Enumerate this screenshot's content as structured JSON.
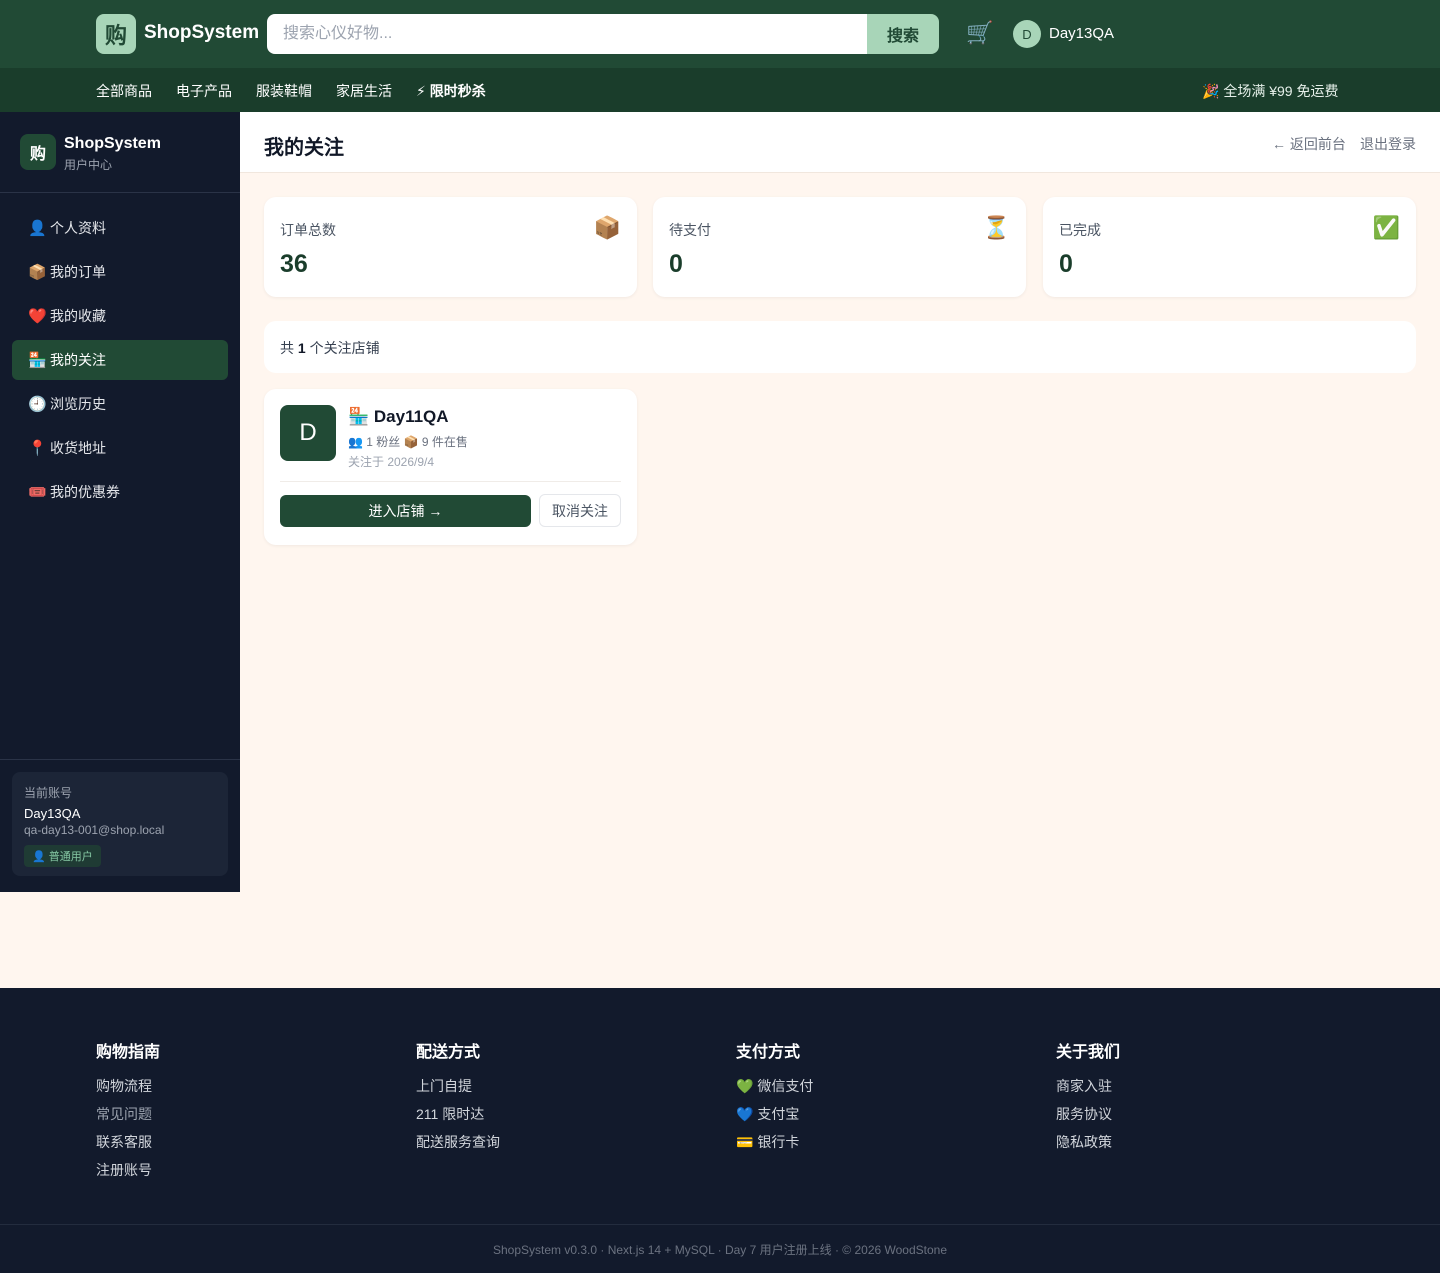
{
  "header": {
    "logo_char": "购",
    "brand": "ShopSystem",
    "search_placeholder": "搜索心仪好物...",
    "search_button": "搜索",
    "cart_icon": "🛒",
    "avatar_initial": "D",
    "user_name": "Day13QA"
  },
  "nav": {
    "items": [
      "全部商品",
      "电子产品",
      "服装鞋帽",
      "家居生活"
    ],
    "flash_icon": "⚡",
    "flash_label": "限时秒杀",
    "promo": "🎉 全场满 ¥99 免运费"
  },
  "sidebar": {
    "logo_char": "购",
    "title": "ShopSystem",
    "subtitle": "用户中心",
    "items": [
      {
        "icon": "👤",
        "label": "个人资料"
      },
      {
        "icon": "📦",
        "label": "我的订单"
      },
      {
        "icon": "❤️",
        "label": "我的收藏"
      },
      {
        "icon": "🏪",
        "label": "我的关注"
      },
      {
        "icon": "🕘",
        "label": "浏览历史"
      },
      {
        "icon": "📍",
        "label": "收货地址"
      },
      {
        "icon": "🎟️",
        "label": "我的优惠券"
      }
    ],
    "account": {
      "label": "当前账号",
      "name": "Day13QA",
      "email": "qa-day13-001@shop.local",
      "badge": "👤 普通用户"
    }
  },
  "main": {
    "title": "我的关注",
    "back": "← 返回前台",
    "logout": "退出登录",
    "stats": [
      {
        "label": "订单总数",
        "value": "36",
        "icon": "📦"
      },
      {
        "label": "待支付",
        "value": "0",
        "icon": "⏳"
      },
      {
        "label": "已完成",
        "value": "0",
        "icon": "✅"
      }
    ],
    "count_prefix": "共",
    "count": "1",
    "count_suffix": "个关注店铺",
    "shop": {
      "initial": "D",
      "name": "🏪 Day11QA",
      "meta": "👥 1 粉丝 📦 9 件在售",
      "date": "关注于 2026/9/4",
      "enter": "进入店铺 →",
      "unfollow": "取消关注"
    }
  },
  "footer": {
    "columns": [
      {
        "title": "购物指南",
        "links": [
          "购物流程",
          "常见问题",
          "联系客服",
          "注册账号"
        ]
      },
      {
        "title": "配送方式",
        "links": [
          "上门自提",
          "211 限时达",
          "配送服务查询"
        ]
      },
      {
        "title": "支付方式",
        "links": [
          "💚 微信支付",
          "💙 支付宝",
          "💳 银行卡"
        ]
      },
      {
        "title": "关于我们",
        "links": [
          "商家入驻",
          "服务协议",
          "隐私政策"
        ]
      }
    ],
    "copyright": "ShopSystem v0.3.0 · Next.js 14 + MySQL · Day 7 用户注册上线 · © 2026 WoodStone"
  }
}
